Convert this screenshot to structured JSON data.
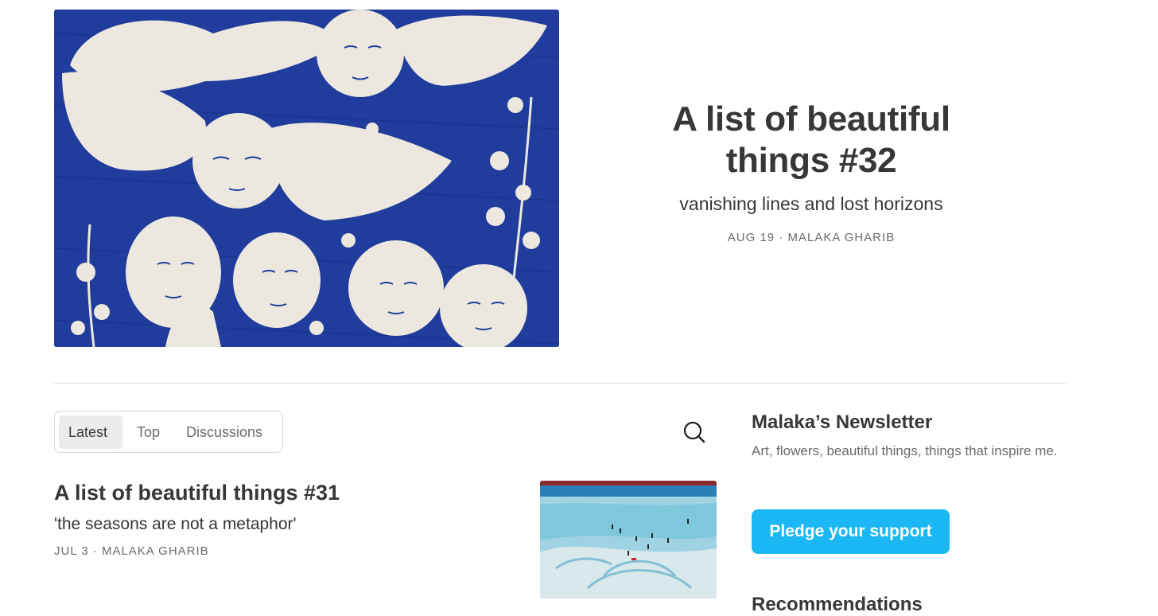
{
  "hero": {
    "image_alt": "blue and white drawing of winged faces and flowers",
    "title": "A list of beautiful things #32",
    "subtitle": "vanishing lines and lost horizons",
    "meta": "AUG 19 · MALAKA GHARIB"
  },
  "tabs": [
    {
      "label": "Latest",
      "active": true
    },
    {
      "label": "Top",
      "active": false
    },
    {
      "label": "Discussions",
      "active": false
    }
  ],
  "search": {
    "icon": "search-icon"
  },
  "posts": [
    {
      "title": "A list of beautiful things #31",
      "subtitle": "'the seasons are not a metaphor'",
      "meta": "JUL 3 · MALAKA GHARIB",
      "thumb_alt": "painting of a beach with people in shallow water"
    }
  ],
  "sidebar": {
    "newsletter_title": "Malaka’s Newsletter",
    "newsletter_desc": "Art, flowers, beautiful things, things that inspire me.",
    "pledge_label": "Pledge your support",
    "recommendations_title": "Recommendations"
  },
  "colors": {
    "accent": "#1bb8f5",
    "text": "#363737",
    "muted": "#6b6b6b",
    "hero_blue": "#1f3a9e"
  }
}
